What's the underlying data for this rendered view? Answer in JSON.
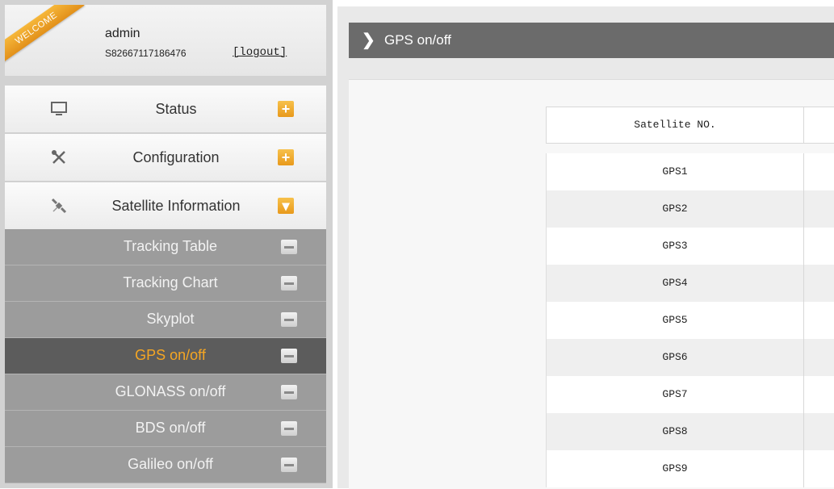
{
  "user": {
    "welcome": "WELCOME",
    "name": "admin",
    "serial": "S82667117186476",
    "logout": "[logout]"
  },
  "menu": {
    "main": [
      {
        "label": "Status",
        "icon": "monitor-icon",
        "toggle": "+"
      },
      {
        "label": "Configuration",
        "icon": "tools-icon",
        "toggle": "+"
      },
      {
        "label": "Satellite Information",
        "icon": "satellite-icon",
        "toggle": "▾"
      }
    ],
    "sub": [
      {
        "label": "Tracking Table"
      },
      {
        "label": "Tracking Chart"
      },
      {
        "label": "Skyplot"
      },
      {
        "label": "GPS on/off",
        "active": true
      },
      {
        "label": "GLONASS on/off"
      },
      {
        "label": "BDS on/off"
      },
      {
        "label": "Galileo on/off"
      }
    ]
  },
  "page": {
    "title": "GPS on/off"
  },
  "table": {
    "header": "Satellite NO.",
    "rows": [
      "GPS1",
      "GPS2",
      "GPS3",
      "GPS4",
      "GPS5",
      "GPS6",
      "GPS7",
      "GPS8",
      "GPS9"
    ]
  },
  "colors": {
    "accent": "#f5a623",
    "submenu_bg": "#9c9c9c",
    "submenu_active_bg": "#5c5c5c",
    "title_bar_bg": "#6b6b6b"
  }
}
